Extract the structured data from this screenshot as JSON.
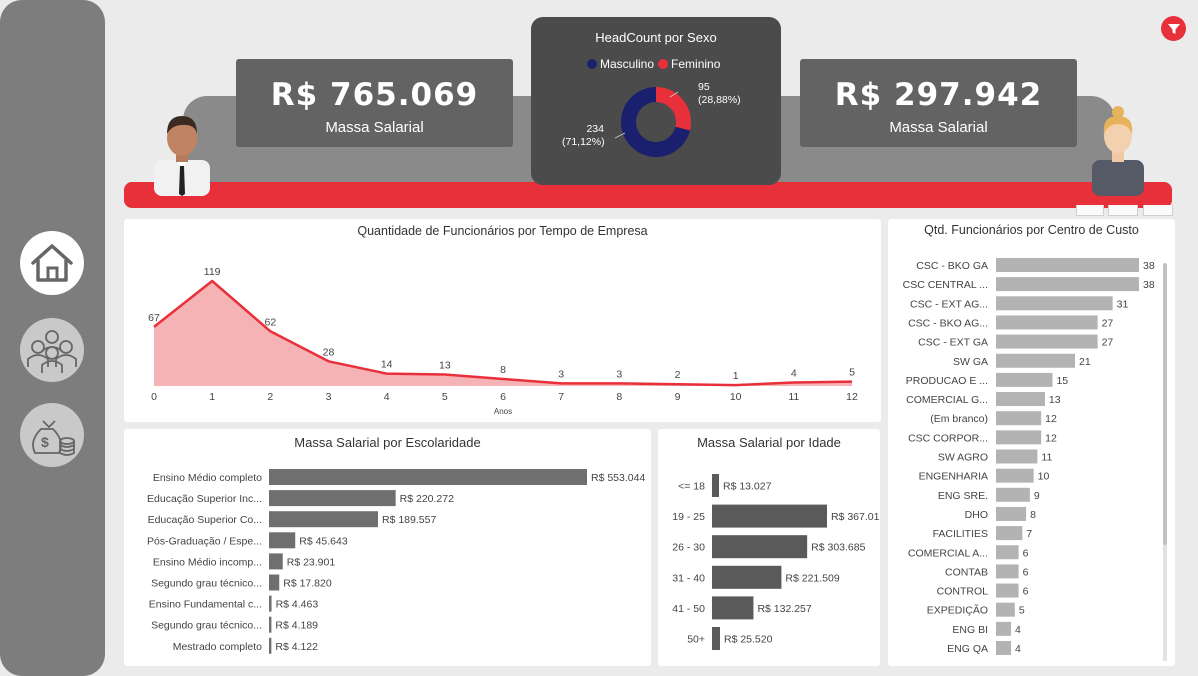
{
  "kpis": {
    "left": {
      "value": "R$ 765.069",
      "label": "Massa Salarial"
    },
    "right": {
      "value": "R$ 297.942",
      "label": "Massa Salarial"
    }
  },
  "headcount": {
    "title": "HeadCount por Sexo",
    "legend": [
      "Masculino",
      "Feminino"
    ],
    "colors": {
      "Masculino": "#1a1f6e",
      "Feminino": "#e8303a"
    },
    "masculino_label": [
      "234",
      "(71,12%)"
    ],
    "feminino_label": [
      "95",
      "(28,88%)"
    ]
  },
  "nav": {
    "icons": [
      "home-icon",
      "people-icon",
      "money-icon"
    ]
  },
  "accent": "#e8303a",
  "chart_data": [
    {
      "type": "area",
      "title": "Quantidade de Funcionários por Tempo de Empresa",
      "xlabel": "Anos",
      "ylabel": "",
      "x": [
        0,
        1,
        2,
        3,
        4,
        5,
        6,
        7,
        8,
        9,
        10,
        11,
        12
      ],
      "values": [
        67,
        119,
        62,
        28,
        14,
        13,
        8,
        3,
        3,
        2,
        1,
        4,
        5
      ],
      "line_color": "#e8303a",
      "fill_color": "#f6b3b6"
    },
    {
      "type": "bar",
      "orientation": "horizontal",
      "title": "Massa Salarial por Escolaridade",
      "categories": [
        "Ensino Médio completo",
        "Educação Superior Inc...",
        "Educação Superior Co...",
        "Pós-Graduação / Espe...",
        "Ensino Médio incomp...",
        "Segundo grau técnico...",
        "Ensino Fundamental c...",
        "Segundo grau técnico...",
        "Mestrado completo"
      ],
      "values": [
        553044,
        220272,
        189557,
        45643,
        23901,
        17820,
        4463,
        4189,
        4122
      ],
      "labels": [
        "R$ 553.044",
        "R$ 220.272",
        "R$ 189.557",
        "R$ 45.643",
        "R$ 23.901",
        "R$ 17.820",
        "R$ 4.463",
        "R$ 4.189",
        "R$ 4.122"
      ],
      "color": "#6f6f6f"
    },
    {
      "type": "bar",
      "orientation": "horizontal",
      "title": "Massa Salarial por Idade",
      "categories": [
        "<= 18",
        "19 - 25",
        "26 - 30",
        "31 - 40",
        "41 - 50",
        "50+"
      ],
      "values": [
        13027,
        367013,
        303685,
        221509,
        132257,
        25520
      ],
      "labels": [
        "R$ 13.027",
        "R$ 367.013",
        "R$ 303.685",
        "R$ 221.509",
        "R$ 132.257",
        "R$ 25.520"
      ],
      "color": "#5a5a5a"
    },
    {
      "type": "bar",
      "orientation": "horizontal",
      "title": "Qtd. Funcionários por Centro de Custo",
      "categories": [
        "CSC - BKO GA",
        "CSC CENTRAL ...",
        "CSC - EXT AG...",
        "CSC - BKO AG...",
        "CSC - EXT GA",
        "SW GA",
        "PRODUCAO E ...",
        "COMERCIAL G...",
        "(Em branco)",
        "CSC CORPOR...",
        "SW AGRO",
        "ENGENHARIA",
        "ENG SRE.",
        "DHO",
        "FACILITIES",
        "COMERCIAL A...",
        "CONTAB",
        "CONTROL",
        "EXPEDIÇÃO",
        "ENG BI",
        "ENG QA"
      ],
      "values": [
        38,
        38,
        31,
        27,
        27,
        21,
        15,
        13,
        12,
        12,
        11,
        10,
        9,
        8,
        7,
        6,
        6,
        6,
        5,
        4,
        4
      ],
      "color": "#b3b3b3"
    }
  ]
}
